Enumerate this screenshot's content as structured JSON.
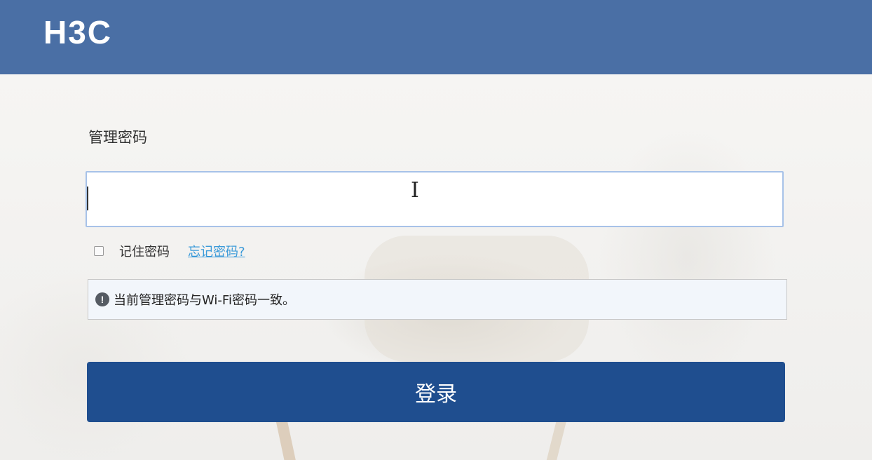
{
  "header": {
    "logo_text": "H3C",
    "background_color": "#4a6fa5"
  },
  "form": {
    "password_label": "管理密码",
    "password_value": "",
    "remember_label": "记住密码",
    "remember_checked": false,
    "forgot_link": "忘记密码?",
    "notice_icon": "exclamation-circle-icon",
    "notice_text": "当前管理密码与Wi-Fi密码一致。",
    "login_button": "登录",
    "button_color": "#1f4e8f",
    "link_color": "#3a9ad9"
  }
}
